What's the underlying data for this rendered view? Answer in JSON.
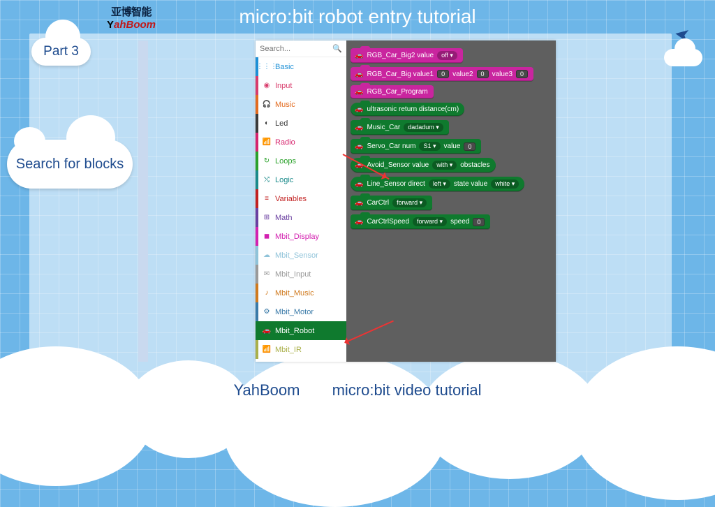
{
  "header": {
    "title": "micro:bit robot entry tutorial",
    "logo_top": "亚博智能",
    "logo_brand": "ahBoom"
  },
  "labels": {
    "part": "Part 3",
    "caption": "Search for blocks"
  },
  "footer": {
    "brand": "YahBoom",
    "tagline": "micro:bit video tutorial"
  },
  "editor": {
    "search_placeholder": "Search...",
    "categories": [
      {
        "name": "Basic",
        "color": "#1e90d6",
        "icon": "⋮⋮⋮"
      },
      {
        "name": "Input",
        "color": "#d83b6b",
        "icon": "◉"
      },
      {
        "name": "Music",
        "color": "#e36b1f",
        "icon": "🎧"
      },
      {
        "name": "Led",
        "color": "#3b3b3b",
        "icon": "◐"
      },
      {
        "name": "Radio",
        "color": "#d6246d",
        "icon": "📶"
      },
      {
        "name": "Loops",
        "color": "#2aa12a",
        "icon": "↻"
      },
      {
        "name": "Logic",
        "color": "#1a8a8a",
        "icon": "⤭"
      },
      {
        "name": "Variables",
        "color": "#c22020",
        "icon": "≡"
      },
      {
        "name": "Math",
        "color": "#6a3fa0",
        "icon": "⊞"
      },
      {
        "name": "Mbit_Display",
        "color": "#d321b0",
        "icon": "◼"
      },
      {
        "name": "Mbit_Sensor",
        "color": "#8fc3d9",
        "icon": "☁"
      },
      {
        "name": "Mbit_Input",
        "color": "#9a9a9a",
        "icon": "✉"
      },
      {
        "name": "Mbit_Music",
        "color": "#d07a1e",
        "icon": "♪"
      },
      {
        "name": "Mbit_Motor",
        "color": "#3a7aa8",
        "icon": "⚙"
      },
      {
        "name": "Mbit_Robot",
        "color": "#0f7a2e",
        "icon": "🚗",
        "selected": true
      },
      {
        "name": "Mbit_IR",
        "color": "#aab04a",
        "icon": "📶"
      }
    ],
    "blocks": [
      {
        "c": "pink",
        "parts": [
          "RGB_Car_Big2 value",
          {
            "pill": "off ▾"
          }
        ]
      },
      {
        "c": "pink",
        "parts": [
          "RGB_Car_Big value1",
          {
            "slot": "0"
          },
          "value2",
          {
            "slot": "0"
          },
          "value3",
          {
            "slot": "0"
          }
        ]
      },
      {
        "c": "pink",
        "parts": [
          "RGB_Car_Program"
        ]
      },
      {
        "c": "green round",
        "parts": [
          "ultrasonic return distance(cm)"
        ]
      },
      {
        "c": "green",
        "parts": [
          "Music_Car",
          {
            "pill": "dadadum ▾"
          }
        ]
      },
      {
        "c": "green",
        "parts": [
          "Servo_Car num",
          {
            "pill": "S1 ▾"
          },
          "value",
          {
            "slot": "0"
          }
        ]
      },
      {
        "c": "green round",
        "parts": [
          "Avoid_Sensor value",
          {
            "pill": "with ▾"
          },
          "obstacles"
        ]
      },
      {
        "c": "green round",
        "parts": [
          "Line_Sensor direct",
          {
            "pill": "left ▾"
          },
          "state value",
          {
            "pill": "white ▾"
          }
        ]
      },
      {
        "c": "green",
        "parts": [
          "CarCtrl",
          {
            "pill": "forward ▾"
          }
        ]
      },
      {
        "c": "green",
        "parts": [
          "CarCtrlSpeed",
          {
            "pill": "forward ▾"
          },
          "speed",
          {
            "slot": "0"
          }
        ]
      }
    ]
  }
}
